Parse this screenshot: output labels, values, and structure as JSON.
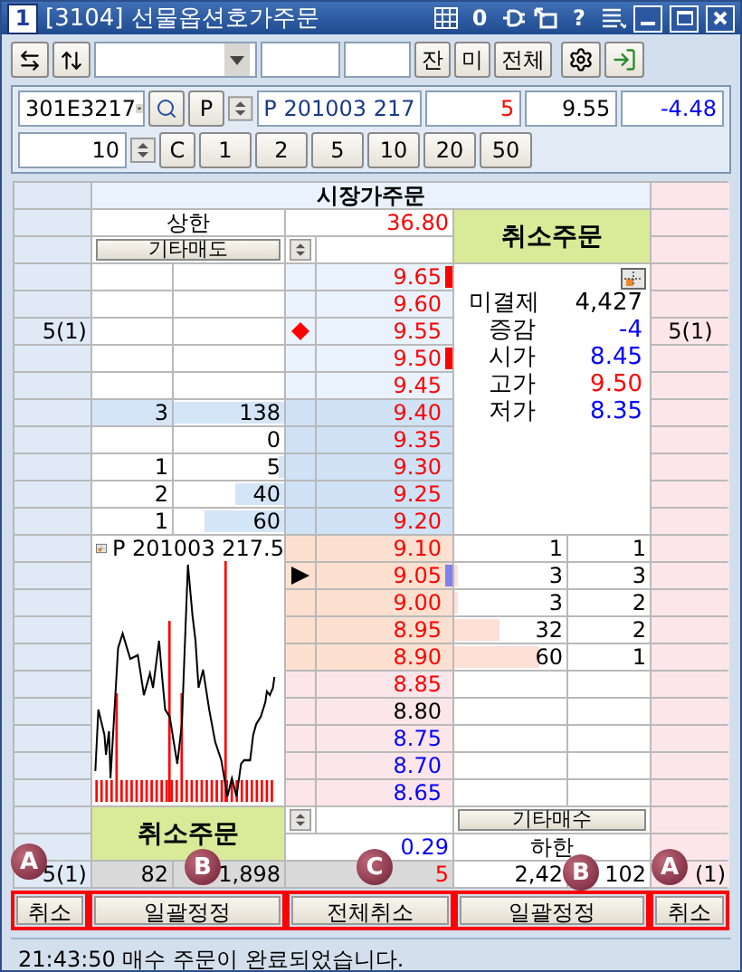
{
  "title_bar": {
    "badge": "1",
    "title": "[3104] 선물옵션호가주문",
    "tools": [
      {
        "kind": "grid"
      },
      {
        "kind": "text",
        "label": "0"
      },
      {
        "kind": "plug"
      },
      {
        "kind": "corner"
      },
      {
        "kind": "text",
        "label": "?"
      },
      {
        "kind": "list"
      }
    ]
  },
  "toolbar": {
    "account_buttons": [
      "잔",
      "미",
      "전체"
    ]
  },
  "order_entry": {
    "code": "301E3217",
    "type_button": "P",
    "name": "P 201003 217",
    "volume": "5",
    "price": "9.55",
    "change": "-4.48",
    "quantity": "10",
    "clear_button": "C",
    "qty_buttons": [
      "1",
      "2",
      "5",
      "10",
      "20",
      "50"
    ]
  },
  "order_book": {
    "header": "시장가주문",
    "upper_label": "상한",
    "upper_price": "36.80",
    "sell_other_button": "기타매도",
    "cancel_top": "취소주문",
    "cancel_bottom": "취소주문",
    "buy_other_button": "기타매수",
    "lower_label": "하한",
    "lower_price": "0.29",
    "chart_title": "P 201003 217.5",
    "info": [
      {
        "label": "미결제",
        "value": "4,427",
        "color": "#000000"
      },
      {
        "label": "증감",
        "value": "-4",
        "color": "#0000ff"
      },
      {
        "label": "시가",
        "value": "8.45",
        "color": "#0000ff"
      },
      {
        "label": "고가",
        "value": "9.50",
        "color": "#ff0000"
      },
      {
        "label": "저가",
        "value": "8.35",
        "color": "#0000ff"
      }
    ],
    "asks": [
      {
        "price": "9.65",
        "color": "#ff0000",
        "shaded": false,
        "flag": true,
        "best": false,
        "marked": false
      },
      {
        "price": "9.60",
        "color": "#ff0000",
        "shaded": false,
        "flag": false,
        "best": false,
        "marked": false
      },
      {
        "price": "9.55",
        "color": "#ff0000",
        "shaded": false,
        "flag": false,
        "best": false,
        "marked": true,
        "sell_orders": "5(1)",
        "buy_orders": "5(1)"
      },
      {
        "price": "9.50",
        "color": "#ff0000",
        "shaded": false,
        "flag": true,
        "best": false,
        "marked": false
      },
      {
        "price": "9.45",
        "color": "#ff0000",
        "shaded": false,
        "flag": false,
        "best": false,
        "marked": false
      },
      {
        "price": "9.40",
        "color": "#ff0000",
        "shaded": true,
        "flag": false,
        "best": true,
        "marked": false,
        "count": "3",
        "qty": "138",
        "level": 1
      },
      {
        "price": "9.35",
        "color": "#ff0000",
        "shaded": true,
        "flag": false,
        "best": false,
        "marked": false,
        "qty": "0",
        "level": 0
      },
      {
        "price": "9.30",
        "color": "#ff0000",
        "shaded": true,
        "flag": false,
        "best": false,
        "marked": false,
        "count": "1",
        "qty": "5",
        "level": 0.05
      },
      {
        "price": "9.25",
        "color": "#ff0000",
        "shaded": true,
        "flag": false,
        "best": false,
        "marked": false,
        "count": "2",
        "qty": "40",
        "level": 0.45
      },
      {
        "price": "9.20",
        "color": "#ff0000",
        "shaded": true,
        "flag": false,
        "best": false,
        "marked": false,
        "count": "1",
        "qty": "60",
        "level": 0.72
      }
    ],
    "bids": [
      {
        "price": "9.10",
        "color": "#ff0000",
        "shaded": true,
        "cursor": false,
        "current": false,
        "qty": "1",
        "count": "1",
        "level": 0
      },
      {
        "price": "9.05",
        "color": "#ff0000",
        "shaded": true,
        "cursor": true,
        "current": true,
        "qty": "3",
        "count": "3",
        "level": 0.03
      },
      {
        "price": "9.00",
        "color": "#ff0000",
        "shaded": true,
        "cursor": false,
        "current": false,
        "qty": "3",
        "count": "2",
        "level": 0.03
      },
      {
        "price": "8.95",
        "color": "#ff0000",
        "shaded": true,
        "cursor": false,
        "current": false,
        "qty": "32",
        "count": "2",
        "level": 0.4
      },
      {
        "price": "8.90",
        "color": "#ff0000",
        "shaded": true,
        "cursor": false,
        "current": false,
        "qty": "60",
        "count": "1",
        "level": 0.75
      },
      {
        "price": "8.85",
        "color": "#ff0000",
        "shaded": false,
        "cursor": false,
        "current": false
      },
      {
        "price": "8.80",
        "color": "#000000",
        "shaded": false,
        "cursor": false,
        "current": false
      },
      {
        "price": "8.75",
        "color": "#0000ff",
        "shaded": false,
        "cursor": false,
        "current": false
      },
      {
        "price": "8.70",
        "color": "#0000ff",
        "shaded": false,
        "cursor": false,
        "current": false
      },
      {
        "price": "8.65",
        "color": "#0000ff",
        "shaded": false,
        "cursor": false,
        "current": false
      }
    ]
  },
  "summary": [
    {
      "text": "5(1)",
      "color": "#000000"
    },
    {
      "text": "82",
      "color": "#000000"
    },
    {
      "text": "1,898",
      "color": "#000000"
    },
    {
      "text": "5",
      "color": "#ff0000"
    },
    {
      "text": "2,42",
      "color": "#000000"
    },
    {
      "text": "102",
      "color": "#000000"
    },
    {
      "text": "(1)",
      "color": "#000000"
    }
  ],
  "action_buttons": [
    {
      "label": "취소",
      "highlighted": true
    },
    {
      "label": "일괄정정",
      "highlighted": true
    },
    {
      "label": "전체취소",
      "highlighted": true
    },
    {
      "label": "일괄정정",
      "highlighted": true
    },
    {
      "label": "취소",
      "highlighted": true
    }
  ],
  "annotations": [
    {
      "label": "A"
    },
    {
      "label": "B"
    },
    {
      "label": "C"
    },
    {
      "label": "B"
    },
    {
      "label": "A"
    }
  ],
  "status_bar": "21:43:50 매수 주문이 완료되었습니다."
}
